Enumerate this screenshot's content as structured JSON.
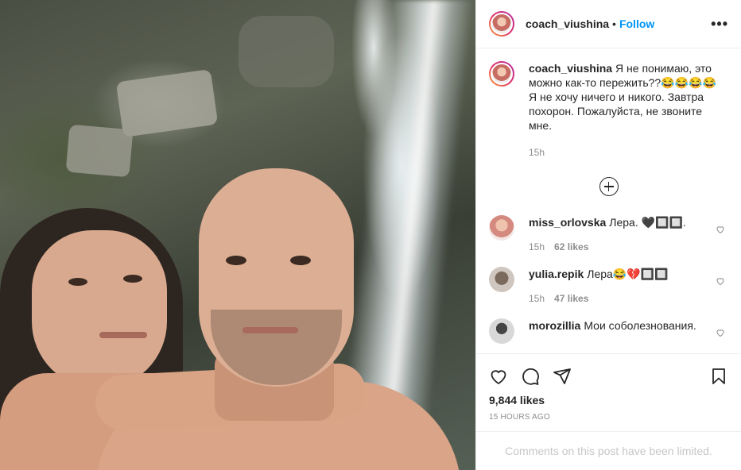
{
  "header": {
    "username": "coach_viushina",
    "separator": "•",
    "follow_label": "Follow",
    "more_label": "•••"
  },
  "caption": {
    "username": "coach_viushina",
    "text": "Я не понимаю, это можно как-то пережить??😂😂😂😂 Я не хочу ничего и никого. Завтра похорон. Пожалуйста, не звоните мне.",
    "time": "15h"
  },
  "comments": [
    {
      "username": "miss_orlovska",
      "text": "Лера. 🖤🔲🔲.",
      "time": "15h",
      "likes": "62 likes"
    },
    {
      "username": "yulia.repik",
      "text": "Лера😂💔🔲🔲",
      "time": "15h",
      "likes": "47 likes"
    },
    {
      "username": "morozillia",
      "text": "Мои соболезнования.",
      "time": "",
      "likes": ""
    }
  ],
  "actions": {
    "icons": [
      "heart-icon",
      "comment-icon",
      "share-icon",
      "bookmark-icon"
    ],
    "likes": "9,844 likes",
    "posted": "15 HOURS AGO"
  },
  "footer": {
    "limited_text": "Comments on this post have been limited."
  },
  "colors": {
    "accent": "#0095f6",
    "text": "#262626",
    "muted": "#8e8e8e",
    "border": "#efefef"
  }
}
